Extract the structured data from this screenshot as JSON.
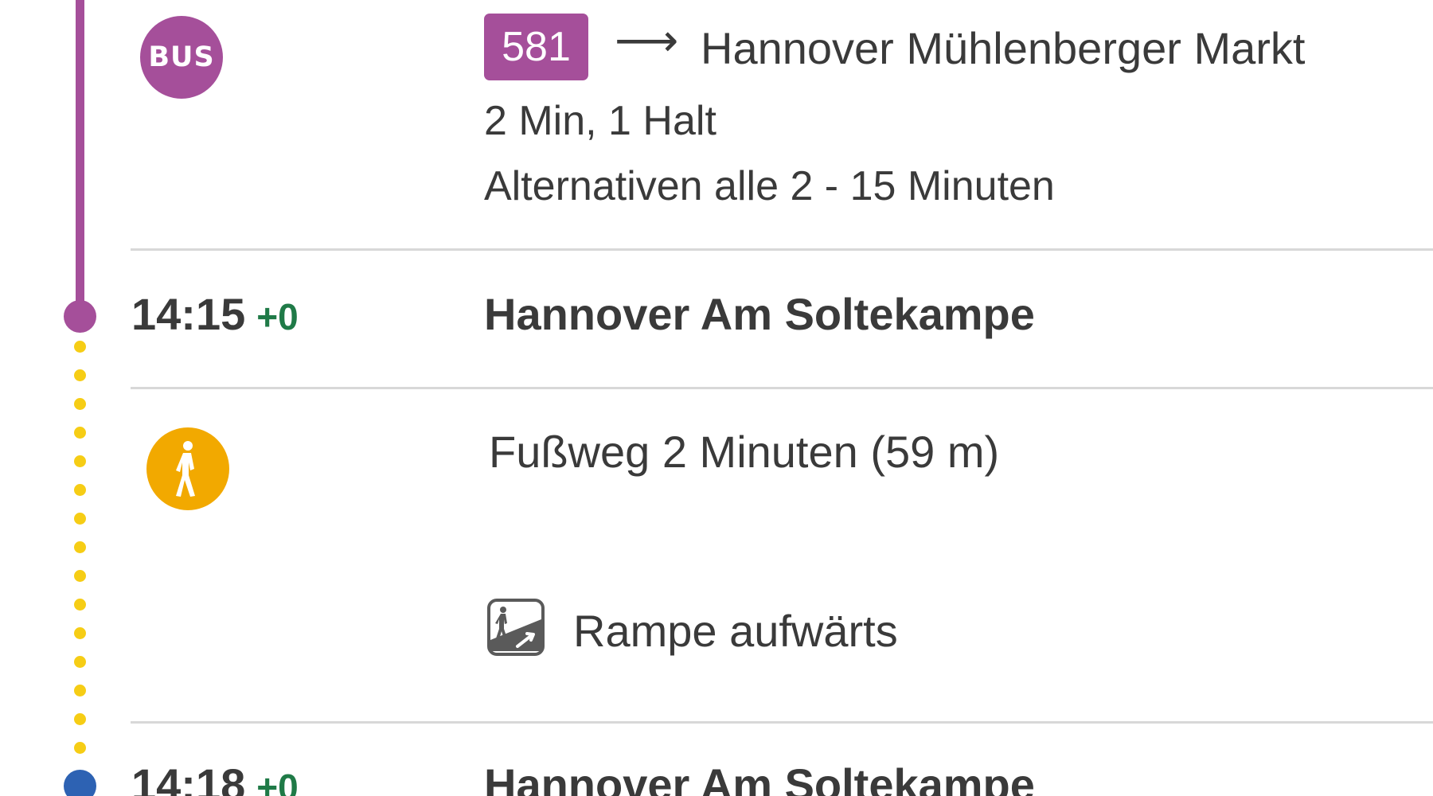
{
  "colors": {
    "bus_purple": "#a54f9a",
    "walk_yellow": "#f6cd15",
    "walk_icon_orange": "#f2a900",
    "stop_blue": "#2d62b3",
    "delay_green": "#1f7a47",
    "divider_gray": "#d8d8d8",
    "text": "#3a3a3a"
  },
  "bus_leg": {
    "mode_icon_label": "BUS",
    "mode_icon": "bus-icon",
    "line": "581",
    "arrow": "⟶",
    "destination": "Hannover Mühlenberger Markt",
    "duration_stops": "2 Min, 1 Halt",
    "alternatives": "Alternativen alle 2 - 15 Minuten"
  },
  "stop_1": {
    "time": "14:15",
    "delay": "+0",
    "name": "Hannover Am Soltekampe"
  },
  "walk_leg": {
    "mode_icon": "pedestrian-icon",
    "description": "Fußweg 2 Minuten (59 m)",
    "accessibility_icon": "ramp-icon",
    "accessibility_label": "Rampe aufwärts"
  },
  "stop_2": {
    "time": "14:18",
    "delay": "+0",
    "name": "Hannover Am Soltekampe"
  }
}
